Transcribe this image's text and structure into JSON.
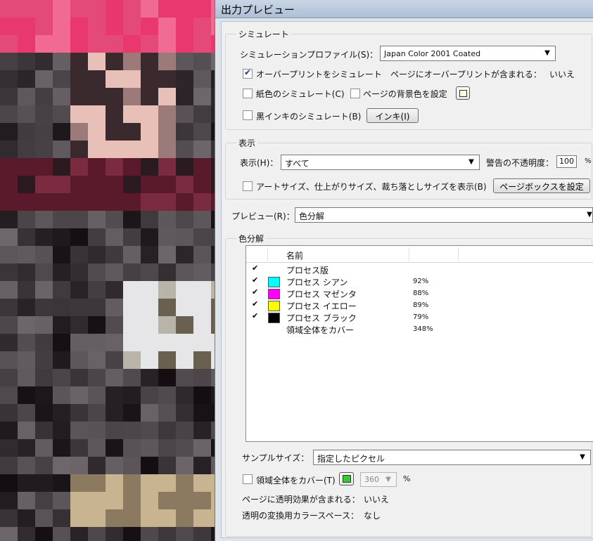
{
  "window": {
    "title": "出力プレビュー"
  },
  "simulate": {
    "group_title": "シミュレート",
    "profile_label": "シミュレーションプロファイル(S)：",
    "profile_value": "Japan Color 2001 Coated",
    "overprint_label": "オーバープリントをシミュレート",
    "overprint_checked": true,
    "overprint_info_label": "ページにオーバープリントが含まれる：",
    "overprint_info_value": "いいえ",
    "paper_color_label": "紙色のシミュレート(C)",
    "page_bg_label": "ページの背景色を設定",
    "black_ink_label": "黒インキのシミュレート(B)",
    "ink_button": "インキ(I)"
  },
  "display": {
    "group_title": "表示",
    "show_label": "表示(H)：",
    "show_value": "すべて",
    "warning_opacity_label": "警告の不透明度：",
    "warning_opacity_value": "100",
    "percent": "%",
    "art_size_label": "アートサイズ、仕上がりサイズ、裁ち落としサイズを表示(B)",
    "page_box_button": "ページボックスを設定"
  },
  "preview": {
    "label": "プレビュー(R)：",
    "value": "色分解"
  },
  "separations": {
    "group_title": "色分解",
    "column_name": "名前",
    "rows": [
      {
        "name": "プロセス版",
        "pct": "",
        "checked": true,
        "color": ""
      },
      {
        "name": "プロセス シアン",
        "pct": "92%",
        "checked": true,
        "color": "#00ffff"
      },
      {
        "name": "プロセス マゼンタ",
        "pct": "88%",
        "checked": true,
        "color": "#ff00ff"
      },
      {
        "name": "プロセス イエロー",
        "pct": "89%",
        "checked": true,
        "color": "#ffff00"
      },
      {
        "name": "プロセス ブラック",
        "pct": "79%",
        "checked": true,
        "color": "#000000"
      },
      {
        "name": "領域全体をカバー",
        "pct": "348%",
        "checked": false,
        "color": ""
      }
    ]
  },
  "bottom": {
    "sample_size_label": "サンプルサイズ：",
    "sample_size_value": "指定したピクセル",
    "total_coverage_label": "領域全体をカバー(T)",
    "total_coverage_color": "#33cc33",
    "total_coverage_value": "360",
    "percent": "%",
    "transparency_label": "ページに透明効果が含まれる：",
    "transparency_value": "いいえ",
    "blend_space_label": "透明の変換用カラースペース：",
    "blend_space_value": "なし"
  }
}
